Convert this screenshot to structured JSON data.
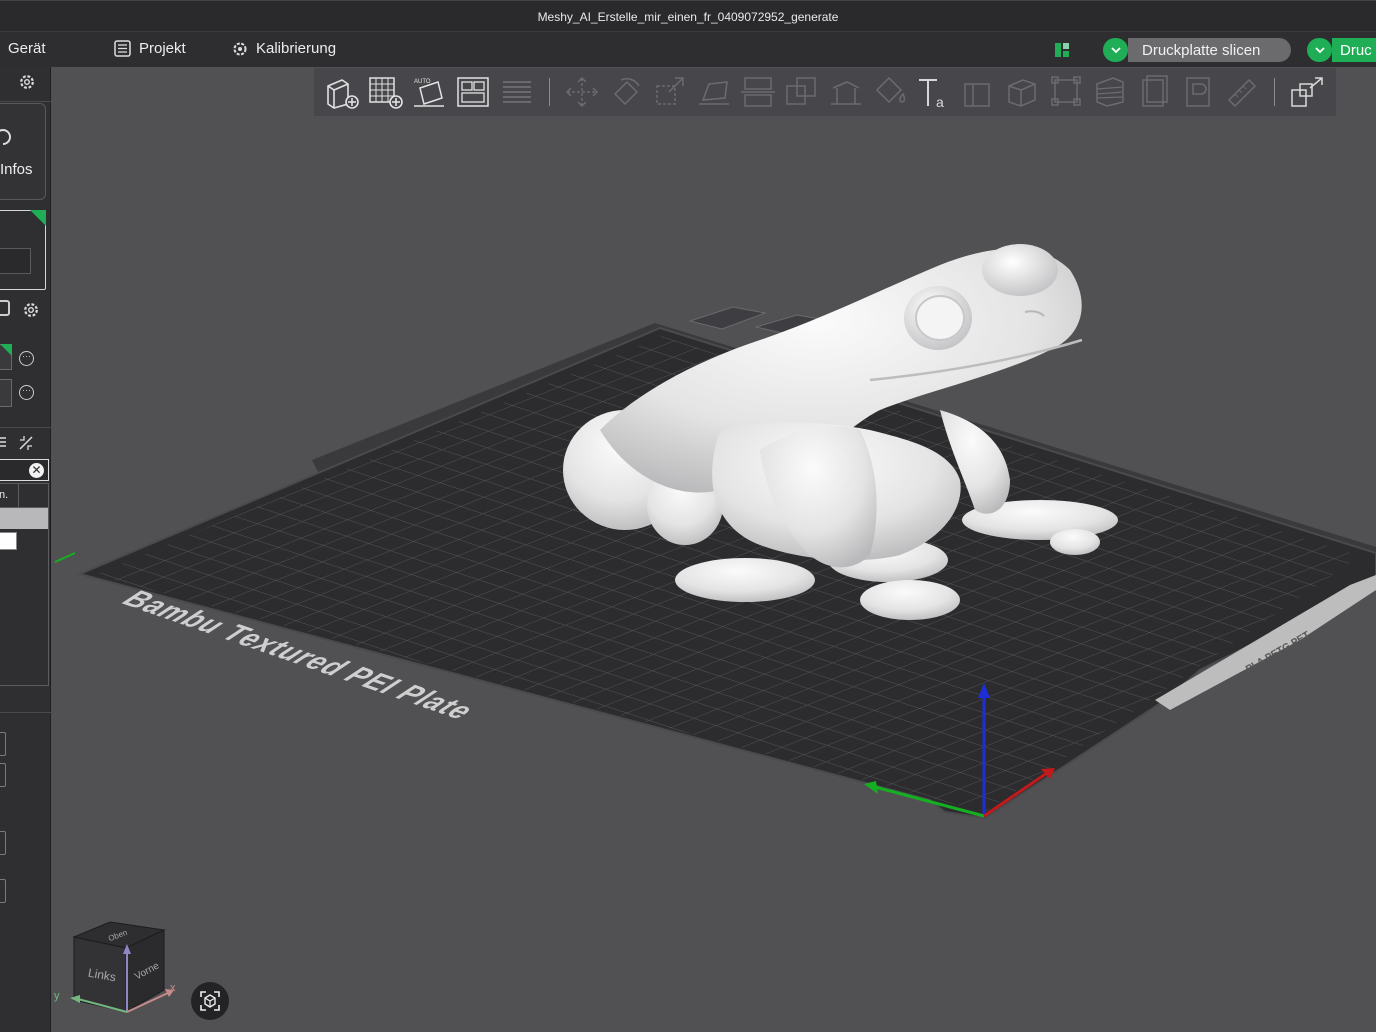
{
  "window": {
    "title": "Meshy_AI_Erstelle_mir_einen_fr_0409072952_generate"
  },
  "menubar": {
    "device": "Gerät",
    "project": "Projekt",
    "calibration": "Kalibrierung",
    "slice_plate": "Druckplatte slicen",
    "print_plate": "Druc"
  },
  "sidebar": {
    "info_label": "Infos",
    "table_header": "n."
  },
  "bed": {
    "label": "Bambu Textured PEI Plate",
    "tag": "PLA PETG PET"
  },
  "nav_cube": {
    "left": "Links",
    "front": "Vorne",
    "top": "Oben",
    "axis_x": "x",
    "axis_y": "y"
  },
  "colors": {
    "accent": "#1fae56",
    "background": "#515154",
    "panel": "#2f2f32",
    "toolbar": "#47474b"
  }
}
